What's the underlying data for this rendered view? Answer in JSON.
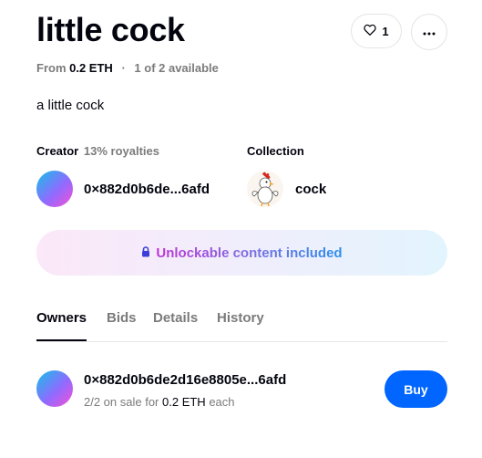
{
  "item": {
    "title": "little cock",
    "like_count": "1",
    "price_prefix": "From",
    "price": "0.2 ETH",
    "availability": "1 of 2 available",
    "description": "a little cock"
  },
  "creator": {
    "label": "Creator",
    "royalties": "13% royalties",
    "address": "0×882d0b6de...6afd"
  },
  "collection": {
    "label": "Collection",
    "name": "cock"
  },
  "unlockable": {
    "text": "Unlockable content included"
  },
  "tabs": [
    {
      "label": "Owners",
      "active": true
    },
    {
      "label": "Bids",
      "active": false
    },
    {
      "label": "Details",
      "active": false
    },
    {
      "label": "History",
      "active": false
    }
  ],
  "owner": {
    "address": "0×882d0b6de2d16e8805e...6afd",
    "sale_prefix": "2/2 on sale for",
    "sale_price": "0.2 ETH",
    "sale_suffix": "each",
    "buy_label": "Buy"
  },
  "icons": [
    "heart-icon",
    "more-options-icon",
    "lock-icon"
  ],
  "colors": {
    "primary": "#0066ff",
    "text": "#04040f",
    "muted": "#7b7b7b"
  }
}
